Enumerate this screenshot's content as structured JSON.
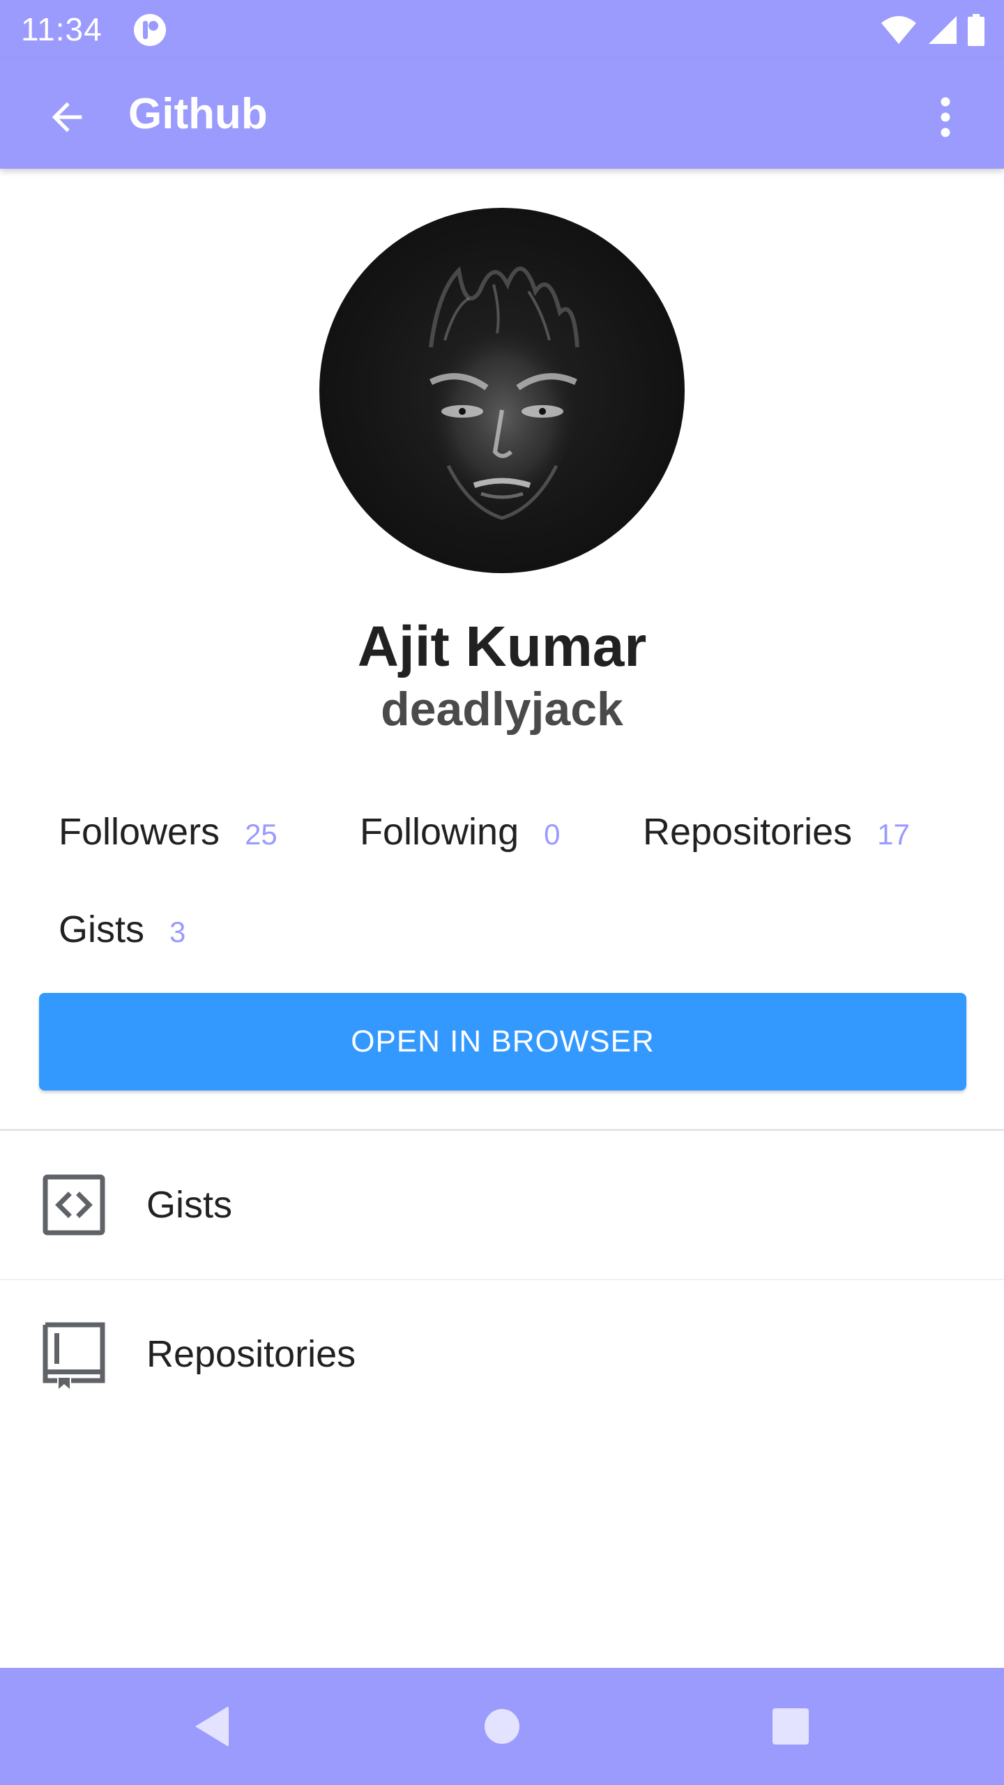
{
  "status_bar": {
    "time": "11:34",
    "icons": [
      "app-notification-icon",
      "wifi-icon",
      "cellular-signal-icon",
      "battery-icon"
    ]
  },
  "app_bar": {
    "title": "Github",
    "back_icon": "arrow-back-icon",
    "menu_icon": "more-vert-icon"
  },
  "profile": {
    "name": "Ajit Kumar",
    "username": "deadlyjack"
  },
  "stats": [
    {
      "label": "Followers",
      "count": "25"
    },
    {
      "label": "Following",
      "count": "0"
    },
    {
      "label": "Repositories",
      "count": "17"
    },
    {
      "label": "Gists",
      "count": "3"
    }
  ],
  "button": {
    "label": "OPEN IN BROWSER"
  },
  "list": [
    {
      "label": "Gists",
      "icon": "code-icon"
    },
    {
      "label": "Repositories",
      "icon": "repo-book-icon"
    }
  ],
  "nav_bar": {
    "icons": [
      "nav-back-icon",
      "nav-home-icon",
      "nav-recents-icon"
    ]
  },
  "colors": {
    "primary": "#9a9bfd",
    "accent_button": "#3399ff",
    "count_text": "#9a9bfd"
  }
}
